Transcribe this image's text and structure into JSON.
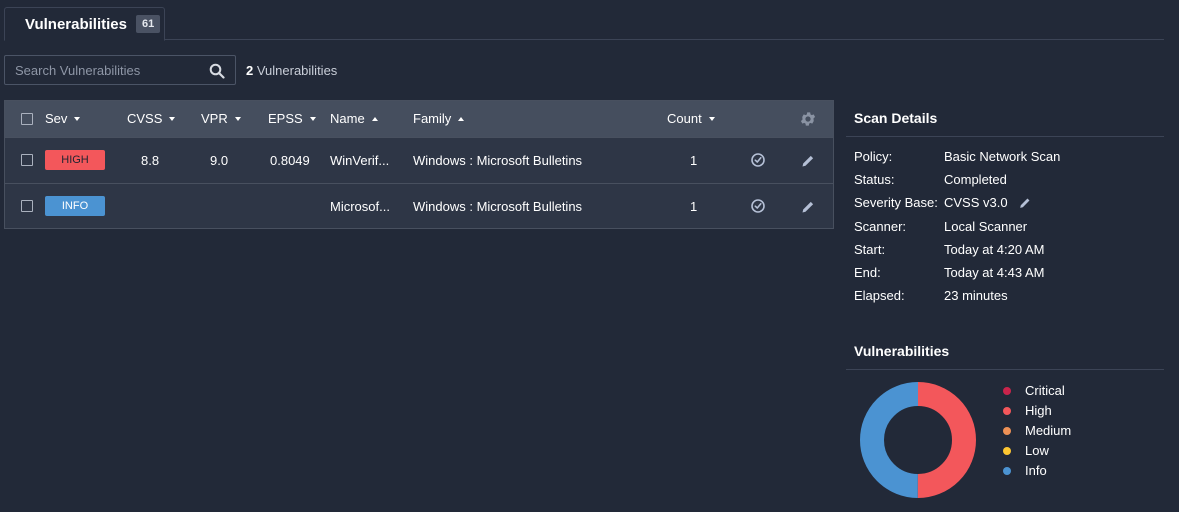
{
  "tab": {
    "label": "Vulnerabilities",
    "count": "61"
  },
  "search": {
    "placeholder": "Search Vulnerabilities",
    "result_number": "2",
    "result_label": " Vulnerabilities"
  },
  "table": {
    "headers": {
      "sev": "Sev",
      "cvss": "CVSS",
      "vpr": "VPR",
      "epss": "EPSS",
      "name": "Name",
      "family": "Family",
      "count": "Count"
    },
    "rows": [
      {
        "sev": "HIGH",
        "sev_color": "#f3575b",
        "cvss": "8.8",
        "vpr": "9.0",
        "epss": "0.8049",
        "name": "WinVerif...",
        "family": "Windows : Microsoft Bulletins",
        "count": "1"
      },
      {
        "sev": "INFO",
        "sev_color": "#4b93d2",
        "cvss": "",
        "vpr": "",
        "epss": "",
        "name": "Microsof...",
        "family": "Windows : Microsoft Bulletins",
        "count": "1"
      }
    ]
  },
  "scan_details": {
    "title": "Scan Details",
    "items": [
      {
        "label": "Policy:",
        "value": "Basic Network Scan"
      },
      {
        "label": "Status:",
        "value": "Completed"
      },
      {
        "label": "Severity Base:",
        "value": "CVSS v3.0"
      },
      {
        "label": "Scanner:",
        "value": "Local Scanner"
      },
      {
        "label": "Start:",
        "value": "Today at 4:20 AM"
      },
      {
        "label": "End:",
        "value": "Today at 4:43 AM"
      },
      {
        "label": "Elapsed:",
        "value": "23 minutes"
      }
    ]
  },
  "vuln_chart": {
    "title": "Vulnerabilities",
    "legend": [
      {
        "label": "Critical",
        "color": "#c9244b"
      },
      {
        "label": "High",
        "color": "#f3575b"
      },
      {
        "label": "Medium",
        "color": "#ee9156"
      },
      {
        "label": "Low",
        "color": "#fdc631"
      },
      {
        "label": "Info",
        "color": "#4b93d2"
      }
    ]
  },
  "chart_data": {
    "type": "pie",
    "categories": [
      "Critical",
      "High",
      "Medium",
      "Low",
      "Info"
    ],
    "values": [
      0,
      1,
      0,
      0,
      1
    ],
    "colors": [
      "#c9244b",
      "#f3575b",
      "#ee9156",
      "#fdc631",
      "#4b93d2"
    ]
  }
}
